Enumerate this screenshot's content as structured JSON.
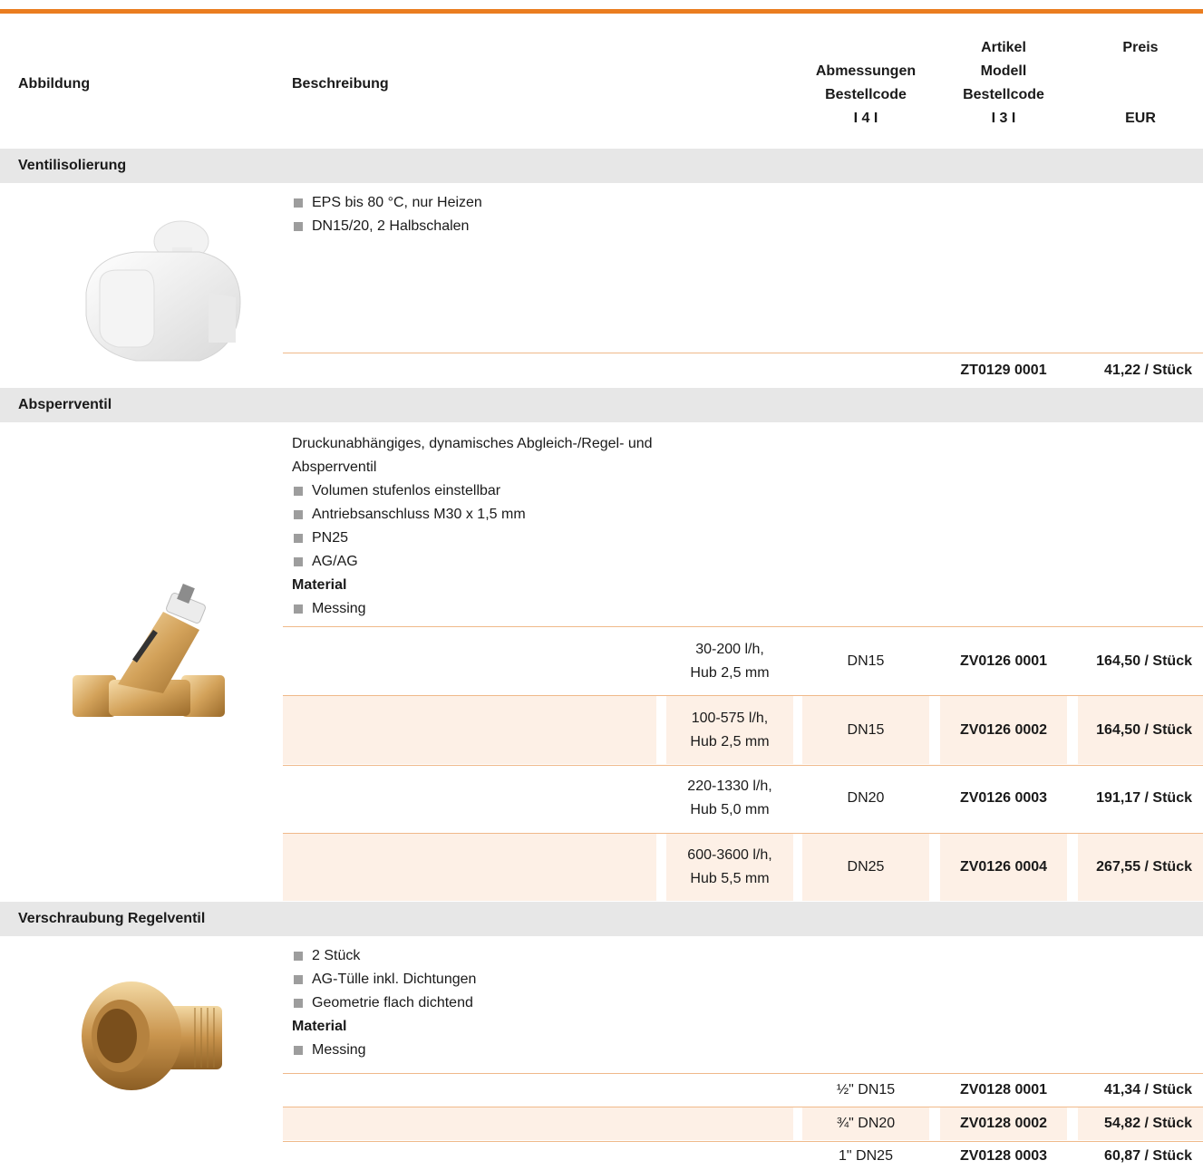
{
  "header": {
    "abbildung": "Abbildung",
    "beschreibung": "Beschreibung",
    "abmessungen": "Abmessungen",
    "bestellcode_a": "Bestellcode",
    "code4": "I 4 I",
    "artikel": "Artikel",
    "modell": "Modell",
    "bestellcode_b": "Bestellcode",
    "code3": "I 3 I",
    "preis": "Preis",
    "eur": "EUR"
  },
  "sections": [
    {
      "title": "Ventilisolierung",
      "bullets": [
        "EPS bis 80 °C, nur Heizen",
        "DN15/20, 2 Halbschalen"
      ],
      "rows": [
        {
          "article": "ZT0129 0001",
          "price": "41,22 / Stück"
        }
      ]
    },
    {
      "title": "Absperrventil",
      "intro_line1": "Druckunabhängiges, dynamisches Abgleich-/Regel- und",
      "intro_line2": "Absperrventil",
      "bullets": [
        "Volumen stufenlos einstellbar",
        "Antriebsanschluss M30 x 1,5 mm",
        "PN25",
        "AG/AG"
      ],
      "material_label": "Material",
      "material": "Messing",
      "rows": [
        {
          "spec1": "30-200 l/h,",
          "spec2": "Hub 2,5 mm",
          "dim": "DN15",
          "article": "ZV0126 0001",
          "price": "164,50 / Stück"
        },
        {
          "spec1": "100-575 l/h,",
          "spec2": "Hub 2,5 mm",
          "dim": "DN15",
          "article": "ZV0126 0002",
          "price": "164,50 / Stück"
        },
        {
          "spec1": "220-1330 l/h,",
          "spec2": "Hub 5,0 mm",
          "dim": "DN20",
          "article": "ZV0126 0003",
          "price": "191,17 / Stück"
        },
        {
          "spec1": "600-3600 l/h,",
          "spec2": "Hub 5,5 mm",
          "dim": "DN25",
          "article": "ZV0126 0004",
          "price": "267,55 / Stück"
        }
      ]
    },
    {
      "title": "Verschraubung Regelventil",
      "bullets": [
        "2 Stück",
        "AG-Tülle inkl. Dichtungen",
        "Geometrie flach dichtend"
      ],
      "material_label": "Material",
      "material": "Messing",
      "rows": [
        {
          "dim": "½\" DN15",
          "article": "ZV0128 0001",
          "price": "41,34 / Stück"
        },
        {
          "dim": "¾\" DN20",
          "article": "ZV0128 0002",
          "price": "54,82 / Stück"
        },
        {
          "dim": "1\" DN25",
          "article": "ZV0128 0003",
          "price": "60,87 / Stück"
        }
      ]
    }
  ],
  "colors": {
    "accent": "#ea7d1f",
    "section_bg": "#e7e7e7",
    "row_shade": "#fdf0e6"
  }
}
